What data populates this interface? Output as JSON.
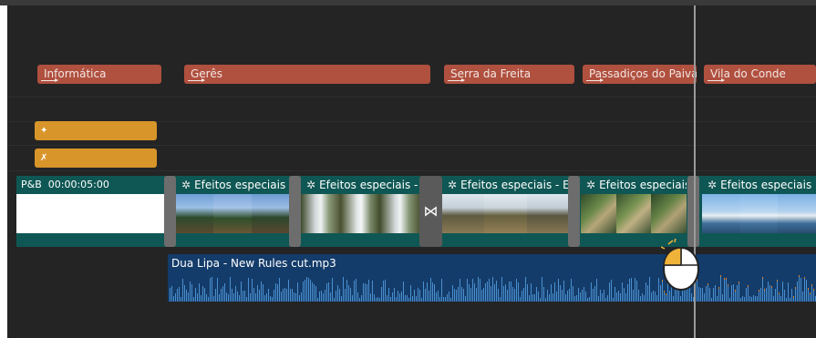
{
  "title_track": {
    "clips": [
      {
        "label": "Informática"
      },
      {
        "label": "Gerês"
      },
      {
        "label": "Serra da Freita"
      },
      {
        "label": "Passadiços do Paiva"
      },
      {
        "label": "Vila do Conde"
      }
    ]
  },
  "overlay_track": {
    "clips": [
      {
        "icon": "sparkle-icon"
      },
      {
        "icon": "figure-icon"
      }
    ]
  },
  "video_track": {
    "pb_clip": {
      "name": "P&B",
      "duration": "00:00:05:00"
    },
    "effect_clips": [
      {
        "label": "Efeitos especiais"
      },
      {
        "label": "Efeitos especiais - Ef"
      },
      {
        "label": "Efeitos especiais - E"
      },
      {
        "label": "Efeitos especiais"
      },
      {
        "label": "Efeitos especiais"
      }
    ],
    "transition_icon": "bowtie-icon"
  },
  "audio_track": {
    "clip_name": "Dua Lipa - New Rules cut.mp3"
  },
  "colors": {
    "background": "#242424",
    "title_clip": "#b0503f",
    "overlay_clip": "#d8952a",
    "video_clip": "#0f5754",
    "audio_clip": "#143c6a",
    "waveform": "#4a8fcf",
    "audio_peak": "#d9832e"
  }
}
